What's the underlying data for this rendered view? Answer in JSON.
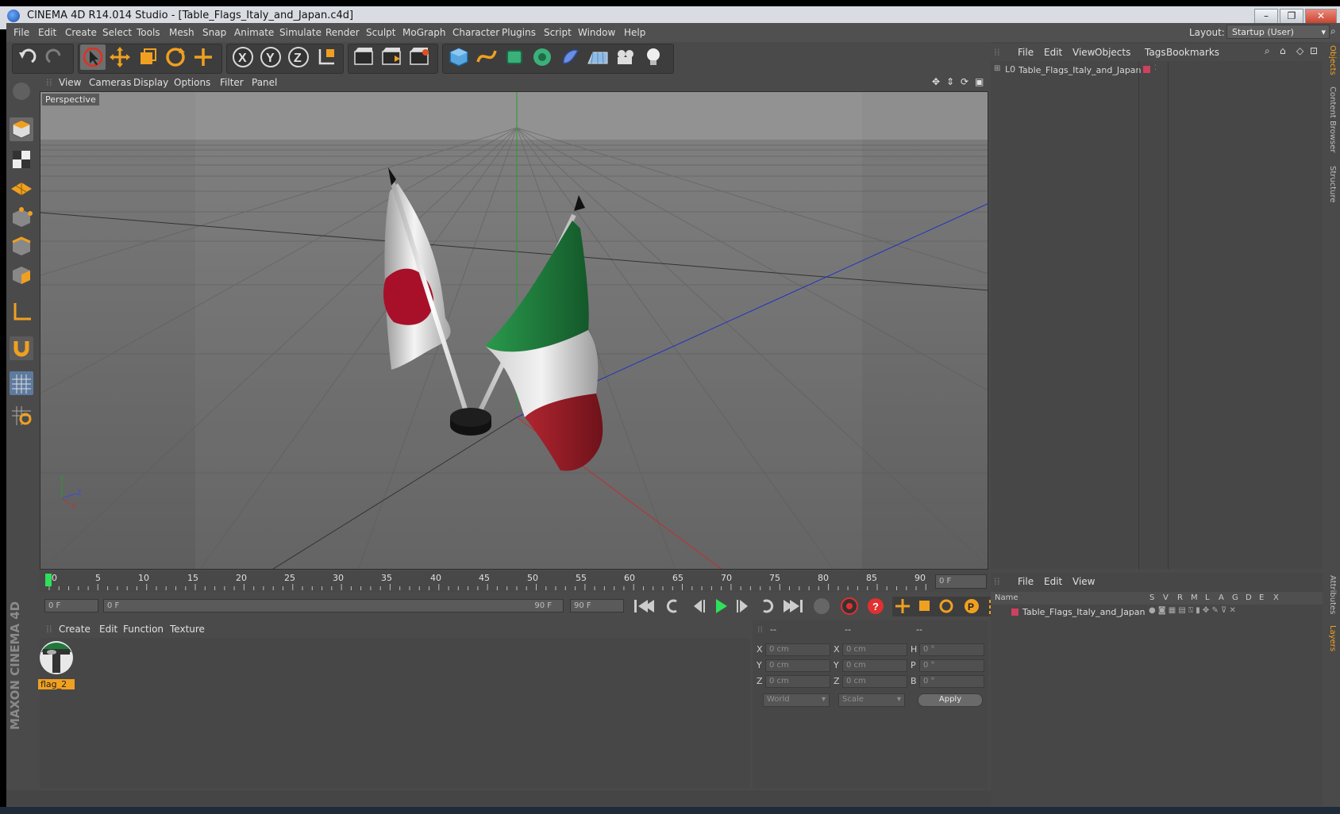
{
  "window": {
    "title": "CINEMA 4D R14.014 Studio - [Table_Flags_Italy_and_Japan.c4d]"
  },
  "menubar": {
    "items": [
      "File",
      "Edit",
      "Create",
      "Select",
      "Tools",
      "Mesh",
      "Snap",
      "Animate",
      "Simulate",
      "Render",
      "Sculpt",
      "MoGraph",
      "Character",
      "Plugins",
      "Script",
      "Window",
      "Help"
    ],
    "layout_label": "Layout:",
    "layout_value": "Startup (User)"
  },
  "viewport": {
    "menu": [
      "View",
      "Cameras",
      "Display",
      "Options",
      "Filter",
      "Panel"
    ],
    "label": "Perspective"
  },
  "timeline": {
    "ticks": [
      "0",
      "5",
      "10",
      "15",
      "20",
      "25",
      "30",
      "35",
      "40",
      "45",
      "50",
      "55",
      "60",
      "65",
      "70",
      "75",
      "80",
      "85",
      "90"
    ],
    "current_frame": "0 F"
  },
  "transport": {
    "start_field": "0 F",
    "range_start": "0 F",
    "range_end": "90 F",
    "end_field": "90 F"
  },
  "material_manager": {
    "menu": [
      "Create",
      "Edit",
      "Function",
      "Texture"
    ],
    "materials": [
      {
        "name": "flag_2"
      }
    ]
  },
  "coordinates": {
    "headers": [
      "--",
      "--",
      "--"
    ],
    "rows": [
      {
        "a_label": "X",
        "a_val": "0 cm",
        "b_label": "X",
        "b_val": "0 cm",
        "c_label": "H",
        "c_val": "0 °"
      },
      {
        "a_label": "Y",
        "a_val": "0 cm",
        "b_label": "Y",
        "b_val": "0 cm",
        "c_label": "P",
        "c_val": "0 °"
      },
      {
        "a_label": "Z",
        "a_val": "0 cm",
        "b_label": "Z",
        "b_val": "0 cm",
        "c_label": "B",
        "c_val": "0 °"
      }
    ],
    "mode1": "World",
    "mode2": "Scale",
    "apply": "Apply"
  },
  "object_manager": {
    "menu": [
      "File",
      "Edit",
      "View",
      "Objects",
      "Tags",
      "Bookmarks"
    ],
    "objects": [
      {
        "name": "Table_Flags_Italy_and_Japan",
        "layer_color": "#d04060"
      }
    ]
  },
  "layer_manager": {
    "menu": [
      "File",
      "Edit",
      "View"
    ],
    "columns": [
      "Name",
      "S",
      "V",
      "R",
      "M",
      "L",
      "A",
      "G",
      "D",
      "E",
      "X"
    ],
    "layers": [
      {
        "name": "Table_Flags_Italy_and_Japan",
        "color": "#d04060"
      }
    ]
  },
  "right_tabs": [
    "Objects",
    "Content Browser",
    "Structure",
    "Attributes",
    "Layers"
  ],
  "branding": "MAXON CINEMA 4D",
  "colors": {
    "accent": "#f0a020",
    "selection": "#f0a020",
    "italy_green": "#1f7a3a",
    "italy_red": "#9c1a22",
    "japan_red": "#a8102a"
  }
}
